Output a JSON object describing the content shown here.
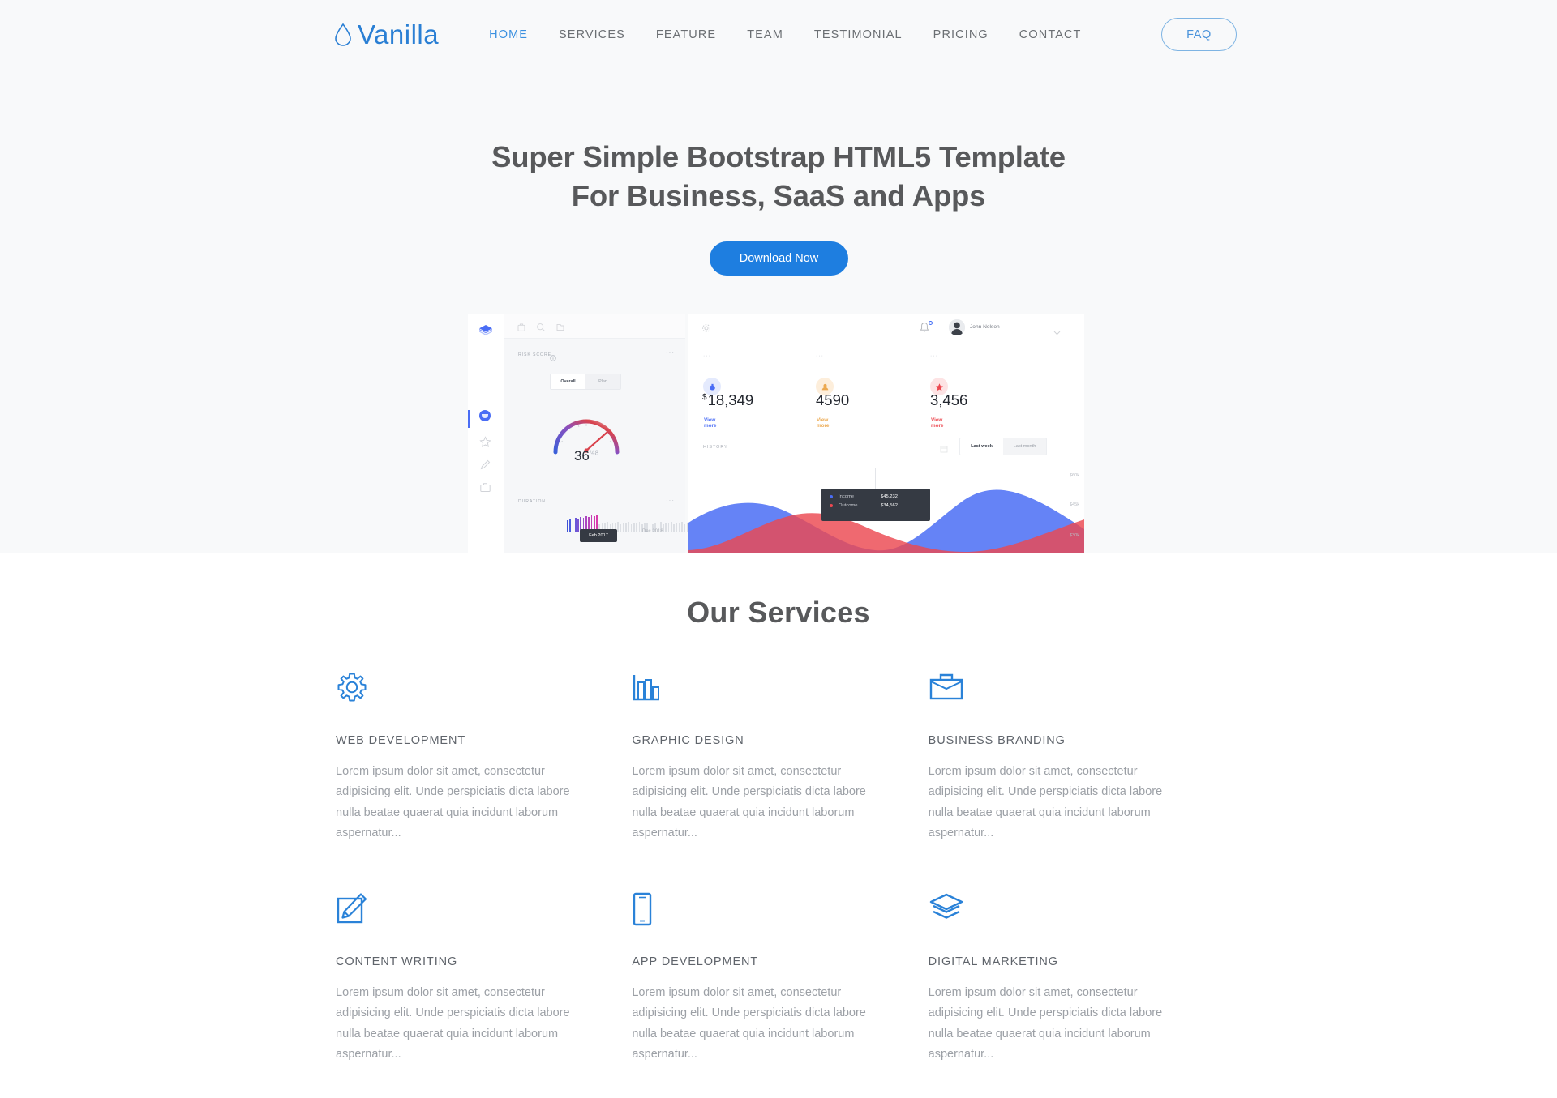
{
  "brand": {
    "name": "Vanilla",
    "logo_icon": "water-drop-icon",
    "color": "#2a7fd4"
  },
  "nav": {
    "items": [
      {
        "label": "HOME",
        "active": true
      },
      {
        "label": "SERVICES",
        "active": false
      },
      {
        "label": "FEATURE",
        "active": false
      },
      {
        "label": "TEAM",
        "active": false
      },
      {
        "label": "TESTIMONIAL",
        "active": false
      },
      {
        "label": "PRICING",
        "active": false
      },
      {
        "label": "CONTACT",
        "active": false
      }
    ],
    "faq_label": "FAQ"
  },
  "hero": {
    "title_line1": "Super Simple Bootstrap HTML5 Template",
    "title_line2": "For Business, SaaS and Apps",
    "cta_label": "Download Now",
    "cta_color": "#1e7ee0",
    "background": "#f8f9fa"
  },
  "dashboard": {
    "left_panel": {
      "toolbar_icons": [
        "briefcase-icon",
        "search-icon",
        "folder-icon"
      ],
      "sidebar_icons": [
        "layers-logo-icon",
        "circle-active-icon",
        "star-icon",
        "pencil-icon",
        "briefcase-icon"
      ],
      "risk_card": {
        "label": "RISK SCORE",
        "info_icon": "info-icon",
        "menu": "···",
        "tabs": [
          {
            "label": "Overall",
            "active": true
          },
          {
            "label": "Plan",
            "active": false
          }
        ],
        "gauge_value": "36",
        "gauge_max": "/48"
      },
      "duration_card": {
        "label": "DURATION",
        "menu": "···",
        "tooltip": "Feb 2017",
        "end_label": "Dec 2018"
      }
    },
    "right_panel": {
      "topbar": {
        "gear_icon": "gear-icon",
        "bell_icon": "bell-icon",
        "avatar": "user-avatar",
        "user_name": "John Nelson",
        "chevron": "chevron-down-icon"
      },
      "stats": [
        {
          "menu": "···",
          "icon": "money-bag-icon",
          "icon_bg": "#e4eafd",
          "icon_color": "#4a6df5",
          "currency": "$",
          "value": "18,349",
          "link": "View more",
          "link_color": "#4a6df5"
        },
        {
          "menu": "···",
          "icon": "user-icon",
          "icon_bg": "#fdeedb",
          "icon_color": "#eca950",
          "currency": "",
          "value": "4590",
          "link": "View more",
          "link_color": "#eca950"
        },
        {
          "menu": "···",
          "icon": "star-icon",
          "icon_bg": "#fde3e4",
          "icon_color": "#ec4850",
          "currency": "",
          "value": "3,456",
          "link": "View more",
          "link_color": "#ec4850"
        }
      ],
      "history": {
        "label": "HISTORY",
        "calendar_icon": "calendar-icon",
        "range_tabs": [
          {
            "label": "Last week",
            "active": true
          },
          {
            "label": "Last month",
            "active": false
          }
        ],
        "y_labels": [
          "$60k",
          "$45k",
          "$30k"
        ],
        "tooltip": {
          "rows": [
            {
              "name": "Income",
              "amount": "$45,232",
              "color": "#4a6df5"
            },
            {
              "name": "Outcome",
              "amount": "$34,562",
              "color": "#ec4850"
            }
          ]
        }
      }
    }
  },
  "services": {
    "heading": "Our Services",
    "items": [
      {
        "icon": "gear-icon",
        "title": "WEB DEVELOPMENT",
        "text": "Lorem ipsum dolor sit amet, consectetur adipisicing elit. Unde perspiciatis dicta labore nulla beatae quaerat quia incidunt laborum aspernatur..."
      },
      {
        "icon": "bar-chart-icon",
        "title": "GRAPHIC DESIGN",
        "text": "Lorem ipsum dolor sit amet, consectetur adipisicing elit. Unde perspiciatis dicta labore nulla beatae quaerat quia incidunt laborum aspernatur..."
      },
      {
        "icon": "briefcase-icon",
        "title": "BUSINESS BRANDING",
        "text": "Lorem ipsum dolor sit amet, consectetur adipisicing elit. Unde perspiciatis dicta labore nulla beatae quaerat quia incidunt laborum aspernatur..."
      },
      {
        "icon": "pencil-square-icon",
        "title": "CONTENT WRITING",
        "text": "Lorem ipsum dolor sit amet, consectetur adipisicing elit. Unde perspiciatis dicta labore nulla beatae quaerat quia incidunt laborum aspernatur..."
      },
      {
        "icon": "mobile-phone-icon",
        "title": "APP DEVELOPMENT",
        "text": "Lorem ipsum dolor sit amet, consectetur adipisicing elit. Unde perspiciatis dicta labore nulla beatae quaerat quia incidunt laborum aspernatur..."
      },
      {
        "icon": "layers-icon",
        "title": "DIGITAL MARKETING",
        "text": "Lorem ipsum dolor sit amet, consectetur adipisicing elit. Unde perspiciatis dicta labore nulla beatae quaerat quia incidunt laborum aspernatur..."
      }
    ],
    "icon_color": "#2a82d8"
  }
}
